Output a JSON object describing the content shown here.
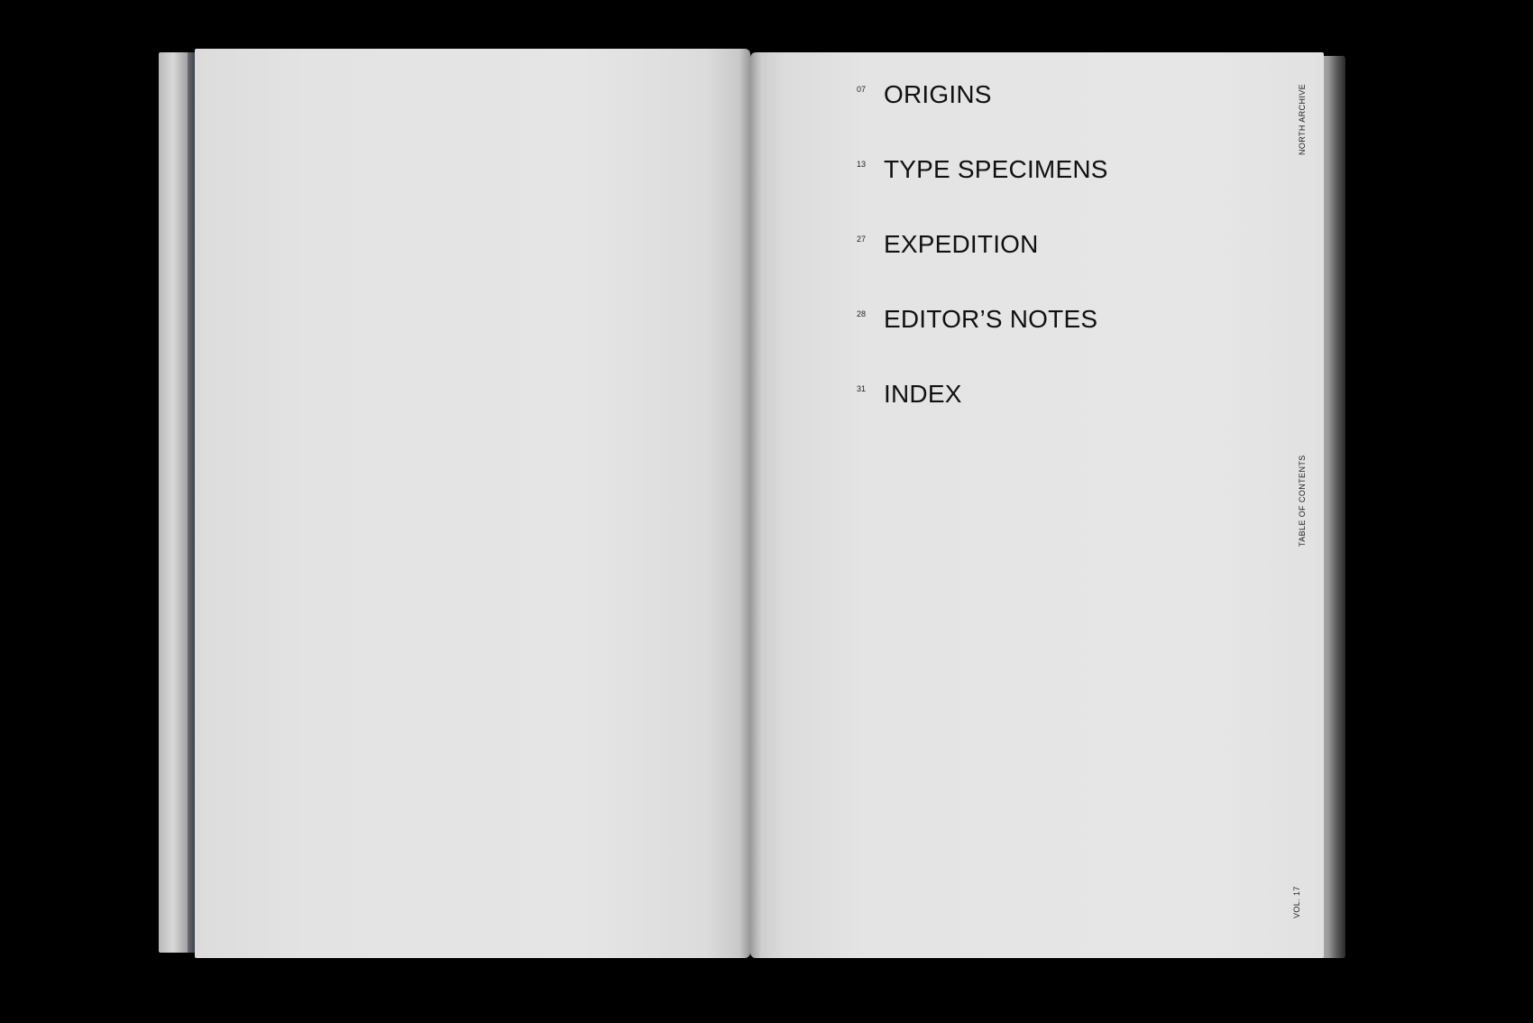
{
  "toc": {
    "entries": [
      {
        "page": "07",
        "title": "ORIGINS"
      },
      {
        "page": "13",
        "title": "TYPE SPECIMENS"
      },
      {
        "page": "27",
        "title": "EXPEDITION"
      },
      {
        "page": "28",
        "title": "EDITOR’S NOTES"
      },
      {
        "page": "31",
        "title": "INDEX"
      }
    ]
  },
  "margin": {
    "publication": "NORTH ARCHIVE",
    "section": "TABLE OF CONTENTS",
    "volume": "VOL. 17"
  }
}
